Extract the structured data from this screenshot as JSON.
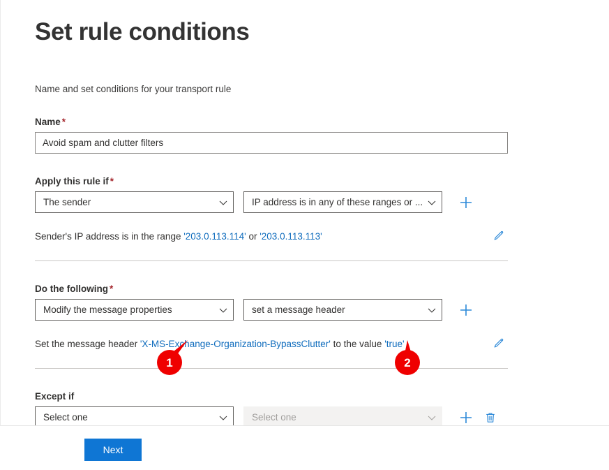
{
  "page": {
    "title": "Set rule conditions",
    "subtitle": "Name and set conditions for your transport rule"
  },
  "name_field": {
    "label": "Name",
    "required_mark": "*",
    "value": "Avoid spam and clutter filters",
    "placeholder": ""
  },
  "apply_if": {
    "label": "Apply this rule if",
    "required_mark": "*",
    "dropdown1": "The sender",
    "dropdown2": "IP address is in any of these ranges or ...",
    "add_label": "+",
    "description_prefix": "Sender's IP address is in the range ",
    "description_value1": "'203.0.113.114'",
    "description_middle": " or ",
    "description_value2": "'203.0.113.113'"
  },
  "do_following": {
    "label": "Do the following",
    "required_mark": "*",
    "dropdown1": "Modify the message properties",
    "dropdown2": "set a message header",
    "add_label": "+",
    "description_prefix": "Set the message header  ",
    "description_header": "'X-MS-Exchange-Organization-BypassClutter'",
    "description_middle": "  to the value  ",
    "description_value": "'true'"
  },
  "except_if": {
    "label": "Except if",
    "dropdown1": "Select one",
    "dropdown2": "Select one",
    "add_label": "+",
    "delete_label": "Delete"
  },
  "footer": {
    "next_label": "Next"
  },
  "callouts": [
    {
      "number": "1"
    },
    {
      "number": "2"
    }
  ],
  "colors": {
    "accent_blue": "#0f76d4",
    "link_blue": "#0f6cbd",
    "icon_blue": "#2b88d8",
    "required_red": "#a4262c",
    "callout_red": "#ef0000"
  },
  "icons": {
    "chevron": "chevron-down-icon",
    "plus": "plus-icon",
    "trash": "trash-icon",
    "pencil": "pencil-edit-icon"
  }
}
